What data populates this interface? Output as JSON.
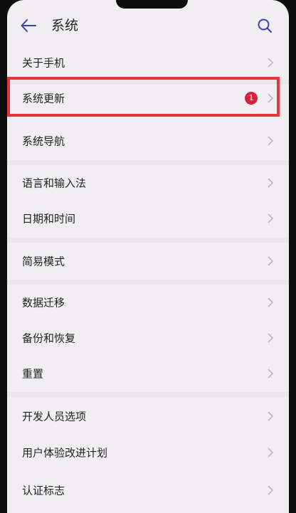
{
  "header": {
    "title": "系统",
    "back_icon": "arrow-left-icon",
    "search_icon": "search-icon"
  },
  "items": [
    {
      "label": "关于手机"
    },
    {
      "label": "系统更新",
      "badge": "1"
    },
    {
      "label": "系统导航"
    },
    {
      "label": "语言和输入法"
    },
    {
      "label": "日期和时间"
    },
    {
      "label": "简易模式"
    },
    {
      "label": "数据迁移"
    },
    {
      "label": "备份和恢复"
    },
    {
      "label": "重置"
    },
    {
      "label": "开发人员选项"
    },
    {
      "label": "用户体验改进计划"
    },
    {
      "label": "认证标志"
    }
  ],
  "colors": {
    "accent": "#3b3fa8",
    "badge": "#d7203d",
    "highlight": "#e8353a",
    "background": "#f0eef1"
  }
}
